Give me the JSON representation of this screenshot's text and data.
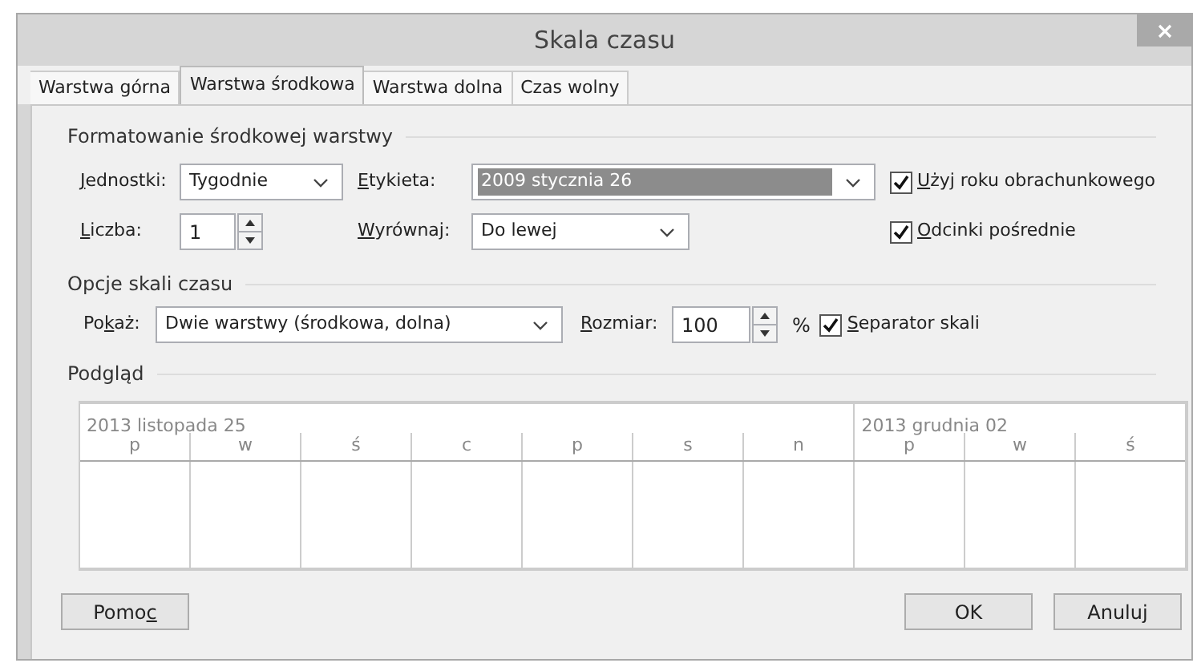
{
  "window": {
    "title": "Skala czasu"
  },
  "tabs": [
    {
      "label": "Warstwa górna",
      "selected": false
    },
    {
      "label": "Warstwa środkowa",
      "selected": true
    },
    {
      "label": "Warstwa dolna",
      "selected": false
    },
    {
      "label": "Czas wolny",
      "selected": false
    }
  ],
  "format_section": {
    "title": "Formatowanie środkowej warstwy",
    "units": {
      "label": {
        "key": "J",
        "post": "ednostki:"
      },
      "value": "Tygodnie"
    },
    "label_field": {
      "label": {
        "key": "E",
        "post": "tykieta:"
      },
      "value": "2009 stycznia 26"
    },
    "fiscal_year": {
      "label": {
        "key": "U",
        "post": "żyj roku obrachunkowego"
      },
      "checked": true
    },
    "count": {
      "label": {
        "key": "L",
        "post": "iczba:"
      },
      "value": "1"
    },
    "align": {
      "label": {
        "key": "W",
        "post": "yrównaj:"
      },
      "value": "Do lewej"
    },
    "tick_lines": {
      "label": {
        "key": "O",
        "post": "dcinki pośrednie"
      },
      "checked": true
    }
  },
  "options_section": {
    "title": "Opcje skali czasu",
    "show": {
      "label": {
        "pre": "Po",
        "key": "k",
        "post": "aż:"
      },
      "value": "Dwie warstwy (środkowa, dolna)"
    },
    "size": {
      "label": {
        "key": "R",
        "post": "ozmiar:"
      },
      "value": "100",
      "unit": "%"
    },
    "separator": {
      "label": {
        "key": "S",
        "post": "eparator skali"
      },
      "checked": true
    }
  },
  "preview": {
    "title": "Podgląd",
    "periods": [
      {
        "label": "2013 listopada 25",
        "days": [
          "p",
          "w",
          "ś",
          "c",
          "p",
          "s",
          "n"
        ]
      },
      {
        "label": "2013 grudnia 02",
        "days": [
          "p",
          "w",
          "ś"
        ]
      }
    ]
  },
  "buttons": {
    "help": {
      "pre": "Pomo",
      "key": "c"
    },
    "ok": "OK",
    "cancel": "Anuluj"
  }
}
